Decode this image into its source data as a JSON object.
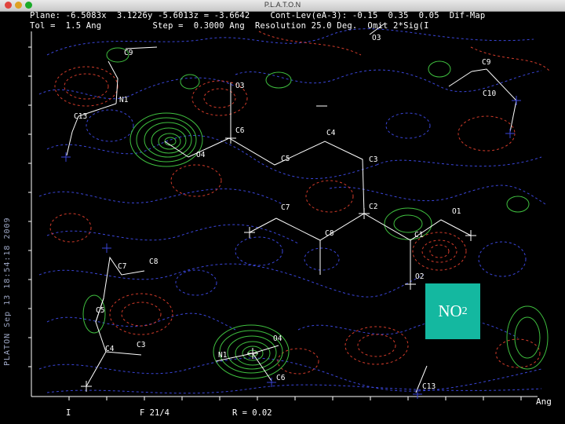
{
  "window": {
    "title": "P.L.A.T.O.N"
  },
  "header": {
    "line1": "Plane: -6.5083x  3.1226y -5.6013z = -3.6642    Cont-Lev(eA-3): -0.15  0.35  0.05  Dif-Map",
    "line2": "Tol =  1.5 Ang          Step =  0.3000 Ang  Resolution 25.0 Deg.  Omit 2*Sig(I"
  },
  "side_text": "PLATON Sep 13 18:54:18 2009",
  "axis": {
    "unit_label": "Ang"
  },
  "bottom": {
    "left": "I",
    "mid1": "F 21/4",
    "mid2": "R = 0.02"
  },
  "badge": {
    "main": "NO",
    "sub": "2"
  },
  "atoms": {
    "c9_top": "C9",
    "n1_top": "N1",
    "c13_top": "C13",
    "o3_mid": "O3",
    "c6_mid": "C6",
    "o4_mid": "O4",
    "c5": "C5",
    "c4_mid": "C4",
    "c3": "C3",
    "o3_top": "O3",
    "c9_right": "C9",
    "c10": "C10",
    "c7_mid": "C7",
    "c2": "C2",
    "o1": "O1",
    "c8_mid": "C8",
    "c1": "C1",
    "o2": "O2",
    "c7_left": "C7",
    "c8_left": "C8",
    "c5_left": "C5",
    "c4_left": "C4",
    "c3_left": "C3",
    "o4_low": "O4",
    "n1_low": "N1",
    "c6_low": "C6",
    "c13_low": "C13"
  },
  "colors": {
    "positive": "#3fbf3f",
    "negative": "#d23b2a",
    "zero": "#3a45d8",
    "bond": "#ffffff"
  }
}
